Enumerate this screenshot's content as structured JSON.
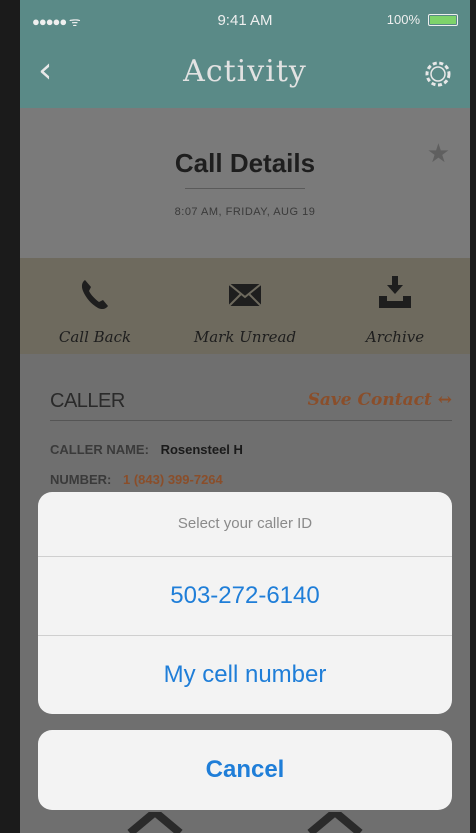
{
  "status_bar": {
    "signal": "●●●●● ᯤ",
    "time": "9:41 AM",
    "battery_label": "100%",
    "battery_level": 1.0
  },
  "navbar": {
    "back_icon": "chevron-left-icon",
    "title": "Activity",
    "settings_icon": "gear-icon"
  },
  "detail": {
    "title": "Call Details",
    "timestamp": "8:07 AM, FRIDAY, AUG 19",
    "favorite_icon": "star-icon"
  },
  "actions": [
    {
      "label": "Call Back",
      "icon": "phone-icon"
    },
    {
      "label": "Mark Unread",
      "icon": "envelope-icon"
    },
    {
      "label": "Archive",
      "icon": "archive-icon"
    }
  ],
  "caller": {
    "heading": "CALLER",
    "save_label": "Save Contact  ↔",
    "name_label": "CALLER NAME:",
    "name_value": "Rosensteel H",
    "number_label": "NUMBER:",
    "number_value": "1 (843) 399-7264"
  },
  "action_sheet": {
    "title": "Select your caller ID",
    "options": [
      "503-272-6140",
      "My cell number"
    ],
    "cancel_label": "Cancel"
  },
  "colors": {
    "nav_teal": "#5a8a87",
    "accent_orange": "#8a4e2a",
    "ios_blue": "#1f7ed8"
  }
}
